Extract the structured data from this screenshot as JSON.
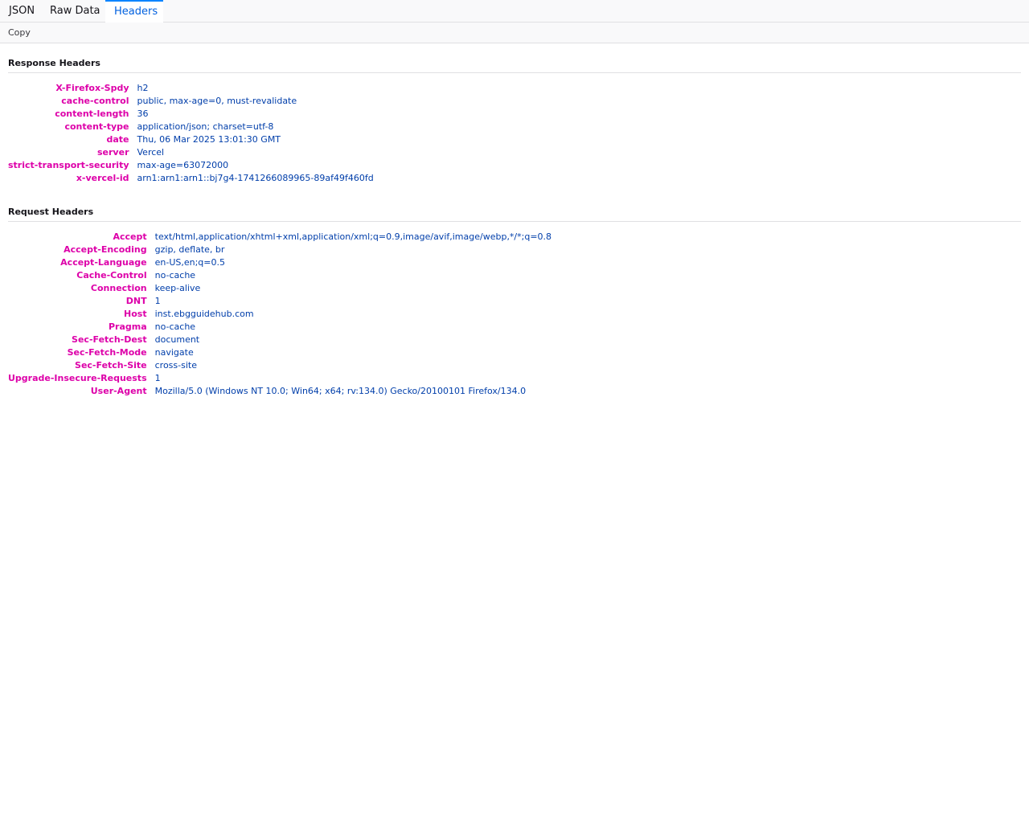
{
  "tabs": [
    {
      "label": "JSON",
      "selected": false
    },
    {
      "label": "Raw Data",
      "selected": false
    },
    {
      "label": "Headers",
      "selected": true
    }
  ],
  "toolbar": {
    "copy_label": "Copy"
  },
  "response": {
    "title": "Response Headers",
    "headers": [
      {
        "name": "X-Firefox-Spdy",
        "value": "h2"
      },
      {
        "name": "cache-control",
        "value": "public, max-age=0, must-revalidate"
      },
      {
        "name": "content-length",
        "value": "36"
      },
      {
        "name": "content-type",
        "value": "application/json; charset=utf-8"
      },
      {
        "name": "date",
        "value": "Thu, 06 Mar 2025 13:01:30 GMT"
      },
      {
        "name": "server",
        "value": "Vercel"
      },
      {
        "name": "strict-transport-security",
        "value": "max-age=63072000"
      },
      {
        "name": "x-vercel-id",
        "value": "arn1:arn1:arn1::bj7g4-1741266089965-89af49f460fd"
      }
    ]
  },
  "request": {
    "title": "Request Headers",
    "headers": [
      {
        "name": "Accept",
        "value": "text/html,application/xhtml+xml,application/xml;q=0.9,image/avif,image/webp,*/*;q=0.8"
      },
      {
        "name": "Accept-Encoding",
        "value": "gzip, deflate, br"
      },
      {
        "name": "Accept-Language",
        "value": "en-US,en;q=0.5"
      },
      {
        "name": "Cache-Control",
        "value": "no-cache"
      },
      {
        "name": "Connection",
        "value": "keep-alive"
      },
      {
        "name": "DNT",
        "value": "1"
      },
      {
        "name": "Host",
        "value": "inst.ebgguidehub.com"
      },
      {
        "name": "Pragma",
        "value": "no-cache"
      },
      {
        "name": "Sec-Fetch-Dest",
        "value": "document"
      },
      {
        "name": "Sec-Fetch-Mode",
        "value": "navigate"
      },
      {
        "name": "Sec-Fetch-Site",
        "value": "cross-site"
      },
      {
        "name": "Upgrade-Insecure-Requests",
        "value": "1"
      },
      {
        "name": "User-Agent",
        "value": "Mozilla/5.0 (Windows NT 10.0; Win64; x64; rv:134.0) Gecko/20100101 Firefox/134.0"
      }
    ]
  },
  "colors": {
    "header_name": "#dd00a9",
    "header_value": "#003eaa",
    "selected_tab": "#0060df",
    "selected_tab_border": "#0a84ff"
  }
}
